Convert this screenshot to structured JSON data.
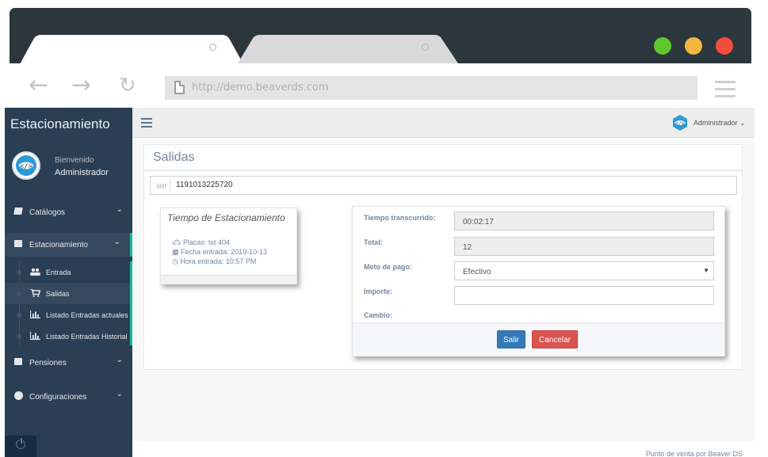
{
  "browser": {
    "url": "http://demo.beaverds.com",
    "colors": {
      "chrome": "#2b373d",
      "btn_green": "#5fc72c",
      "btn_yellow": "#f4b73f",
      "btn_red": "#f44d3c"
    }
  },
  "sidebar": {
    "brand": "Estacionamiento",
    "welcome": "Bienvenido",
    "user": "Administrador",
    "menus": {
      "catalogos": {
        "label": "Catálogos",
        "icon": "book-icon"
      },
      "estacionamiento": {
        "label": "Estacionamiento",
        "icon": "folder-open-icon"
      },
      "pensiones": {
        "label": "Pensiones",
        "icon": "folder-open-icon"
      },
      "configuraciones": {
        "label": "Configuraciones",
        "icon": "cogs-icon"
      }
    },
    "submenu": {
      "entrada": "Entrada",
      "salidas": "Salidas",
      "listado_actuales": "Listado Entradas actuales",
      "listado_historial": "Listado Entradas Historial"
    }
  },
  "topnav": {
    "user": "Administrador"
  },
  "page": {
    "title": "Salidas",
    "barcode": "1191013225720"
  },
  "parking": {
    "title": "Tiempo de Estacionamiento",
    "placas": "Placas: txt 404",
    "fecha": "Fecha entrada: 2019-10-13",
    "hora": "Hora entrada: 10:57 PM"
  },
  "payment": {
    "tiempo_label": "Tiempo transcurrido:",
    "tiempo_value": "00:02:17",
    "total_label": "Total:",
    "total_value": "12",
    "metodo_label": "Meto de pago:",
    "metodo_value": "Efectivo",
    "importe_label": "Importe:",
    "importe_value": "",
    "cambio_label": "Cambio:",
    "salir": "Salir",
    "cancelar": "Cancelar"
  },
  "footer": {
    "text": "Punto de venta por Beaver DS"
  }
}
